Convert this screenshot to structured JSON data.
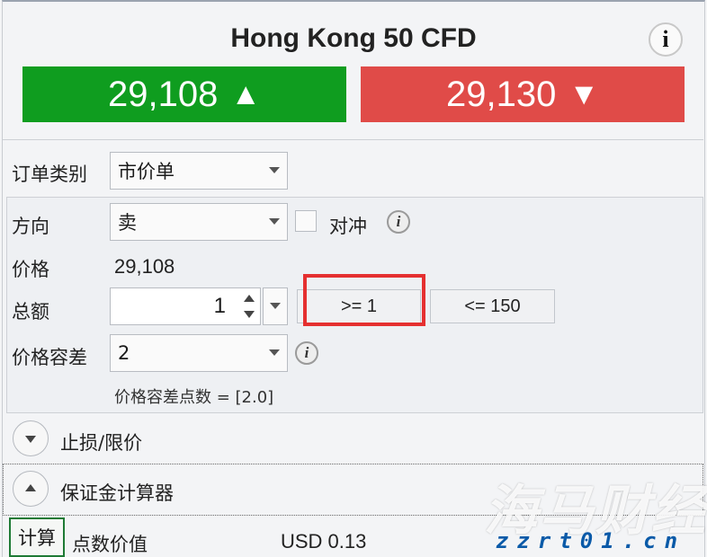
{
  "header": {
    "title": "Hong Kong 50 CFD",
    "info_label": "i"
  },
  "quotes": {
    "sell_price": "29,108",
    "sell_arrow": "▲",
    "buy_price": "29,130",
    "buy_arrow": "▼",
    "sell_color": "#0f9d1f",
    "buy_color": "#e04b48"
  },
  "order_type": {
    "label": "订单类别",
    "value": "市价单"
  },
  "direction": {
    "label": "方向",
    "value": "卖",
    "hedge_label": "对冲"
  },
  "price": {
    "label": "价格",
    "value": "29,108"
  },
  "amount": {
    "label": "总额",
    "value": "1",
    "min_label": ">= 1",
    "max_label": "<= 150"
  },
  "tolerance": {
    "label": "价格容差",
    "value": "2",
    "note": "价格容差点数 = [2.0]"
  },
  "sections": {
    "stop_limit": "止损/限价",
    "margin_calculator": "保证金计算器"
  },
  "calculator": {
    "button_label": "计算",
    "point_value_label": "点数价值",
    "point_value": "USD 0.13"
  },
  "watermark": {
    "cn": "海马财经",
    "en": "zzrt01.cn"
  }
}
